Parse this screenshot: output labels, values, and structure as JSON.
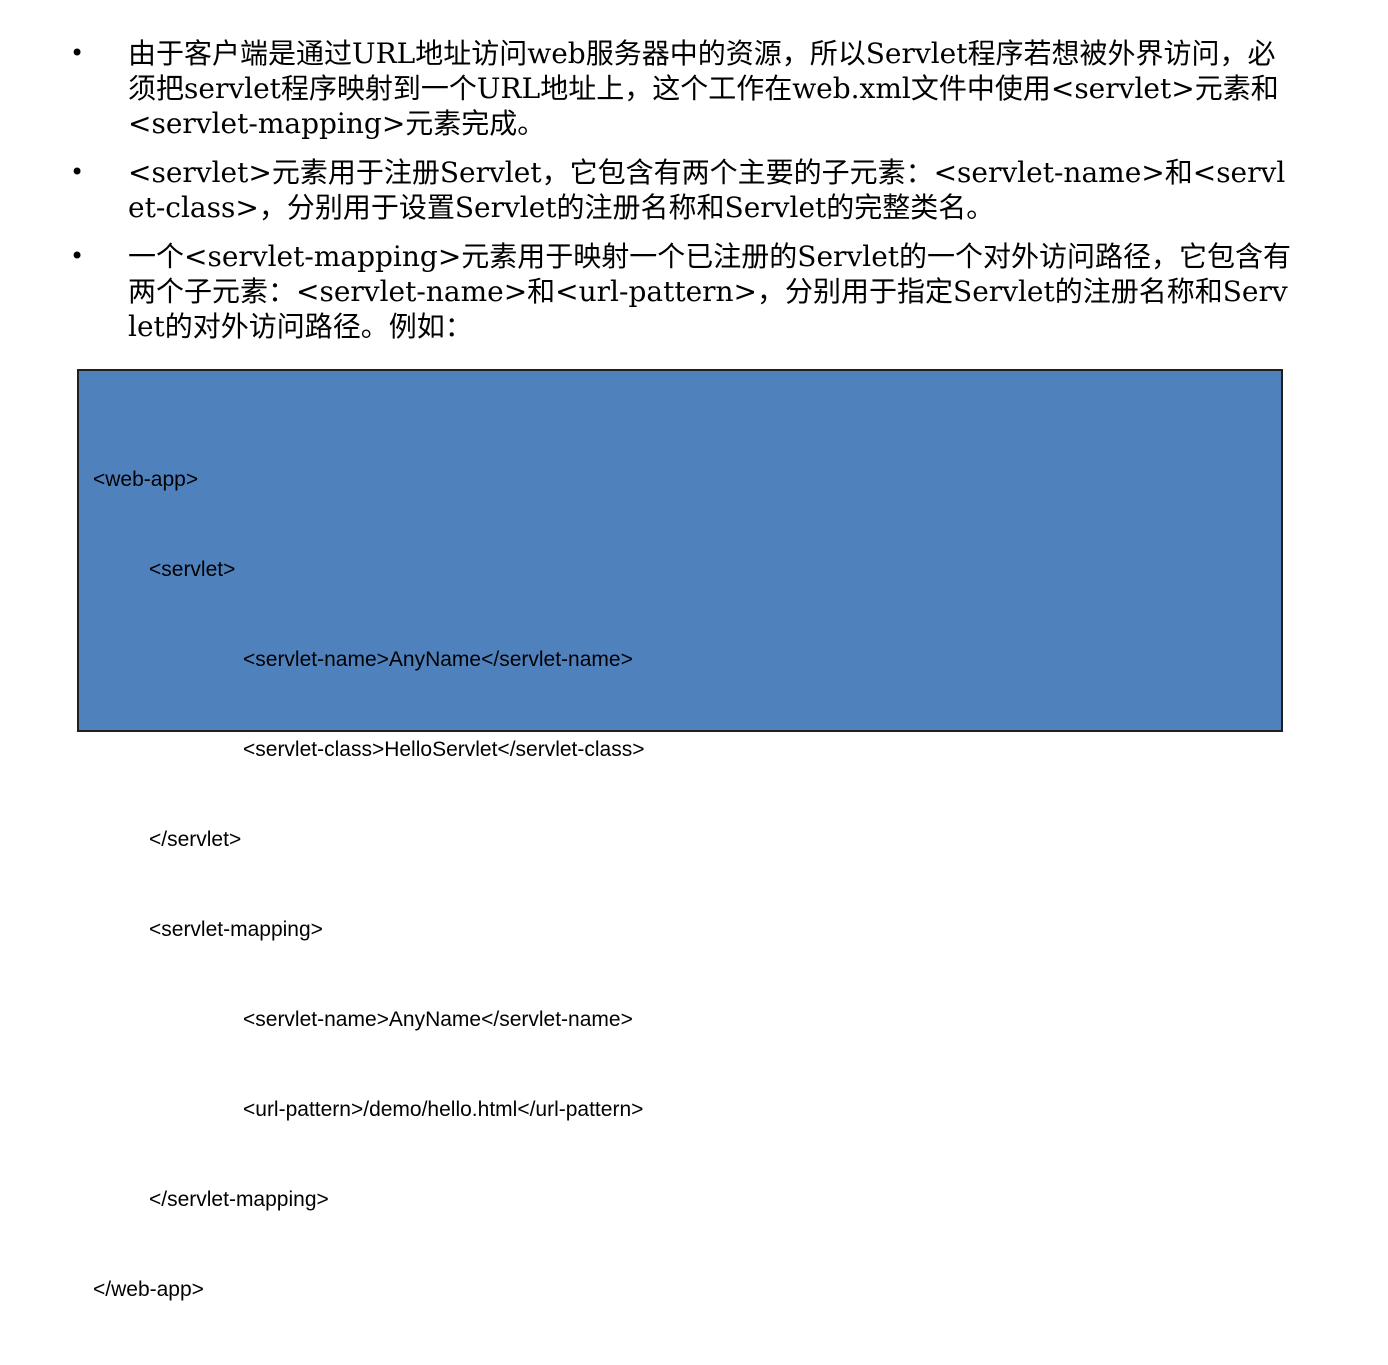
{
  "bullets": [
    {
      "symbol": "•",
      "text": "由于客户端是通过URL地址访问web服务器中的资源，所以Servlet程序若想被外界访问，必须把servlet程序映射到一个URL地址上，这个工作在web.xml文件中使用<servlet>元素和<servlet-mapping>元素完成。"
    },
    {
      "symbol": "•",
      "text": "<servlet>元素用于注册Servlet，它包含有两个主要的子元素：<servlet-name>和<servlet-class>，分别用于设置Servlet的注册名称和Servlet的完整类名。"
    },
    {
      "symbol": "•",
      "text": "一个<servlet-mapping>元素用于映射一个已注册的Servlet的一个对外访问路径，它包含有两个子元素：<servlet-name>和<url-pattern>，分别用于指定Servlet的注册名称和Servlet的对外访问路径。例如："
    }
  ],
  "code_example": {
    "background_color": "#4f81bd",
    "border_color": "#1f1f1f",
    "lines": [
      "<web-app>",
      "<servlet>",
      "<servlet-name>AnyName</servlet-name>",
      "<servlet-class>HelloServlet</servlet-class>",
      "</servlet>",
      "<servlet-mapping>",
      "<servlet-name>AnyName</servlet-name>",
      "<url-pattern>/demo/hello.html</url-pattern>",
      "</servlet-mapping>",
      "</web-app>"
    ]
  }
}
